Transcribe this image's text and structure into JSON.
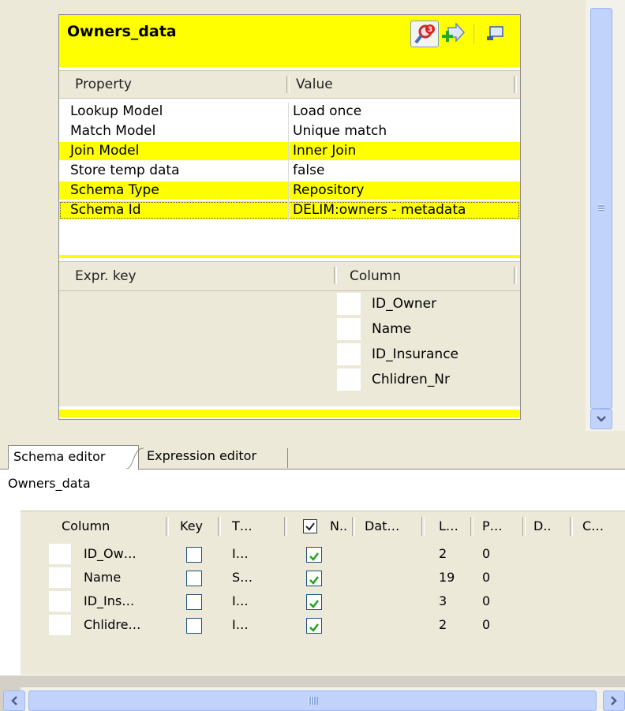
{
  "lookup": {
    "title": "Owners_data",
    "tools": {
      "lookup_icon": "magnifier-badge-icon",
      "lookup_badge": "3",
      "add_icon": "arrow-plus-icon",
      "minimize_icon": "window-minimize-icon"
    },
    "prop_headers": [
      "Property",
      "Value"
    ],
    "properties": [
      {
        "property": "Lookup Model",
        "value": "Load once"
      },
      {
        "property": "Match Model",
        "value": "Unique match"
      },
      {
        "property": "Join Model",
        "value": "Inner Join"
      },
      {
        "property": "Store temp data",
        "value": "false"
      },
      {
        "property": "Schema Type",
        "value": "Repository"
      },
      {
        "property": "Schema Id",
        "value": "DELIM:owners - metadata"
      }
    ],
    "expr_headers": [
      "Expr. key",
      "Column"
    ],
    "columns": [
      "ID_Owner",
      "Name",
      "ID_Insurance",
      "Chlidren_Nr"
    ]
  },
  "editor": {
    "tabs": [
      "Schema editor",
      "Expression editor"
    ],
    "title": "Owners_data",
    "headers": {
      "column": "Column",
      "key": "Key",
      "type": "T…",
      "nullable": "N..",
      "date": "Dat…",
      "length": "L…",
      "precision": "P…",
      "default": "D..",
      "comment": "C…"
    },
    "rows": [
      {
        "column": "ID_Ow…",
        "key": false,
        "type": "I…",
        "nullable": true,
        "length": "2",
        "precision": "0"
      },
      {
        "column": "Name",
        "key": false,
        "type": "S…",
        "nullable": true,
        "length": "19",
        "precision": "0"
      },
      {
        "column": "ID_Ins…",
        "key": false,
        "type": "I…",
        "nullable": true,
        "length": "3",
        "precision": "0"
      },
      {
        "column": "Chlidre…",
        "key": false,
        "type": "I…",
        "nullable": true,
        "length": "2",
        "precision": "0"
      }
    ]
  },
  "colors": {
    "highlight": "#ffff00",
    "scroll": "#c1d3fb",
    "check": "#21a121"
  }
}
